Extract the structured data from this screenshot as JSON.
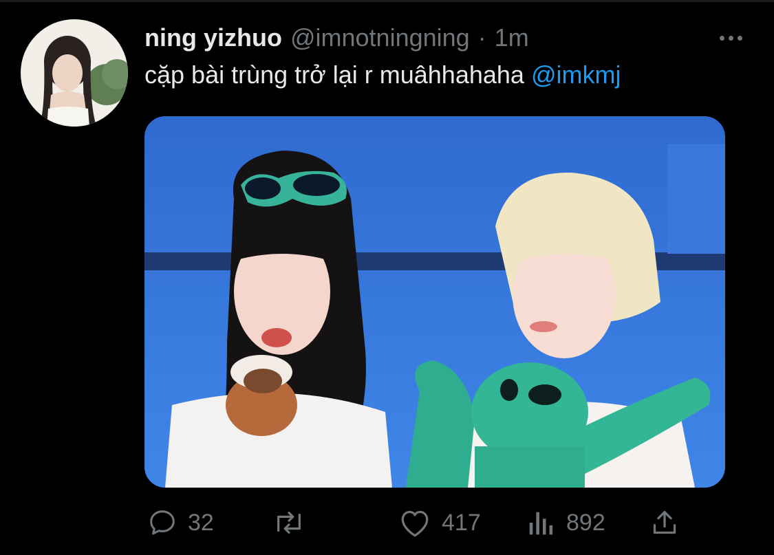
{
  "tweet": {
    "display_name": "ning yizhuo",
    "handle": "@imnotningning",
    "separator": "·",
    "timestamp": "1m",
    "text": "cặp bài trùng trở lại r muâhhahaha ",
    "mention": "@imkmj",
    "avatar": "profile-photo",
    "media": "photo"
  },
  "actions": {
    "reply": {
      "icon": "reply-icon",
      "count": "32"
    },
    "retweet": {
      "icon": "retweet-icon",
      "count": ""
    },
    "like": {
      "icon": "heart-icon",
      "count": "417"
    },
    "views": {
      "icon": "views-icon",
      "count": "892"
    },
    "share": {
      "icon": "share-icon",
      "count": ""
    }
  },
  "colors": {
    "background": "#000000",
    "primary_text": "#e7e9ea",
    "secondary_text": "#71767b",
    "accent": "#1d9bf0"
  }
}
